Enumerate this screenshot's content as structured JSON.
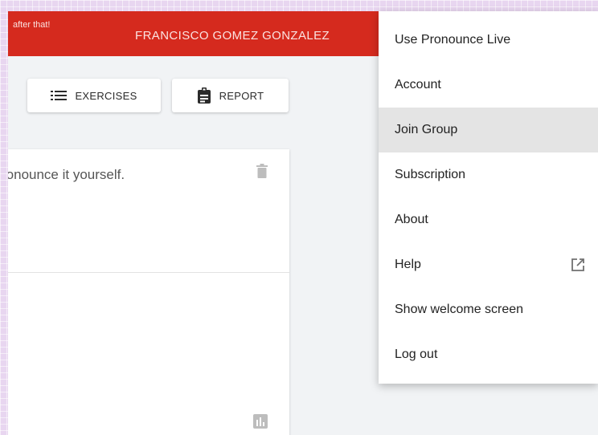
{
  "header": {
    "tagline": "after that!",
    "user_name": "FRANCISCO GOMEZ GONZALEZ"
  },
  "toolbar": {
    "exercises_label": "EXERCISES",
    "report_label": "REPORT"
  },
  "card": {
    "text": "ronounce it yourself."
  },
  "menu": {
    "items": [
      {
        "label": "Use Pronounce Live"
      },
      {
        "label": "Account"
      },
      {
        "label": "Join Group"
      },
      {
        "label": "Subscription"
      },
      {
        "label": "About"
      },
      {
        "label": "Help"
      },
      {
        "label": "Show welcome screen"
      },
      {
        "label": "Log out"
      }
    ]
  },
  "colors": {
    "header_red": "#d52a1e",
    "active_menu_bg": "#e4e4e4"
  },
  "icons": {
    "exercises": "list-icon",
    "report": "clipboard-icon",
    "card_delete": "trash-icon",
    "card_stats": "bar-chart-icon",
    "help": "open-in-new-icon"
  }
}
